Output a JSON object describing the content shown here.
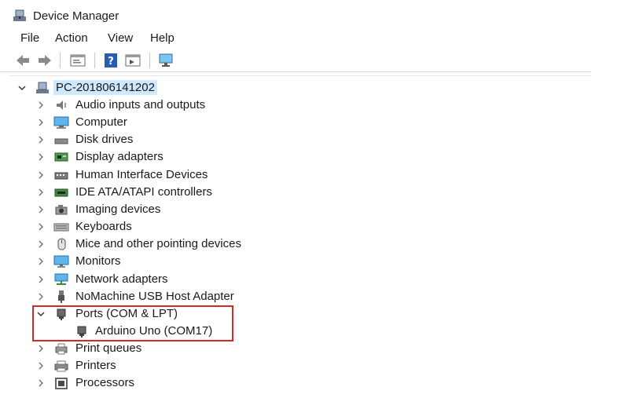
{
  "window": {
    "title": "Device Manager"
  },
  "menu": [
    "File",
    "Action",
    "View",
    "Help"
  ],
  "toolbar": {
    "buttons": [
      "back-arrow-icon",
      "forward-arrow-icon",
      "properties-icon",
      "help-icon",
      "update-driver-icon",
      "scan-hardware-icon"
    ]
  },
  "tree": {
    "root": {
      "label": "PC-201806141202",
      "expanded": true
    },
    "categories": [
      {
        "label": "Audio inputs and outputs",
        "icon": "speaker-icon",
        "expanded": false
      },
      {
        "label": "Computer",
        "icon": "computer-icon",
        "expanded": false
      },
      {
        "label": "Disk drives",
        "icon": "disk-drive-icon",
        "expanded": false
      },
      {
        "label": "Display adapters",
        "icon": "display-adapter-icon",
        "expanded": false
      },
      {
        "label": "Human Interface Devices",
        "icon": "hid-icon",
        "expanded": false
      },
      {
        "label": "IDE ATA/ATAPI controllers",
        "icon": "ide-controller-icon",
        "expanded": false
      },
      {
        "label": "Imaging devices",
        "icon": "camera-icon",
        "expanded": false
      },
      {
        "label": "Keyboards",
        "icon": "keyboard-icon",
        "expanded": false
      },
      {
        "label": "Mice and other pointing devices",
        "icon": "mouse-icon",
        "expanded": false
      },
      {
        "label": "Monitors",
        "icon": "monitor-icon",
        "expanded": false
      },
      {
        "label": "Network adapters",
        "icon": "network-adapter-icon",
        "expanded": false
      },
      {
        "label": "NoMachine USB Host Adapter",
        "icon": "usb-icon",
        "expanded": false
      },
      {
        "label": "Ports (COM & LPT)",
        "icon": "port-icon",
        "expanded": true
      },
      {
        "label": "Arduino Uno (COM17)",
        "icon": "port-icon",
        "child": true
      },
      {
        "label": "Print queues",
        "icon": "print-queue-icon",
        "expanded": false
      },
      {
        "label": "Printers",
        "icon": "printer-icon",
        "expanded": false
      },
      {
        "label": "Processors",
        "icon": "processor-icon",
        "expanded": false
      }
    ]
  },
  "colors": {
    "selection": "#cde8ff",
    "highlight_box": "#d62728",
    "accent": "#2a79d8"
  }
}
